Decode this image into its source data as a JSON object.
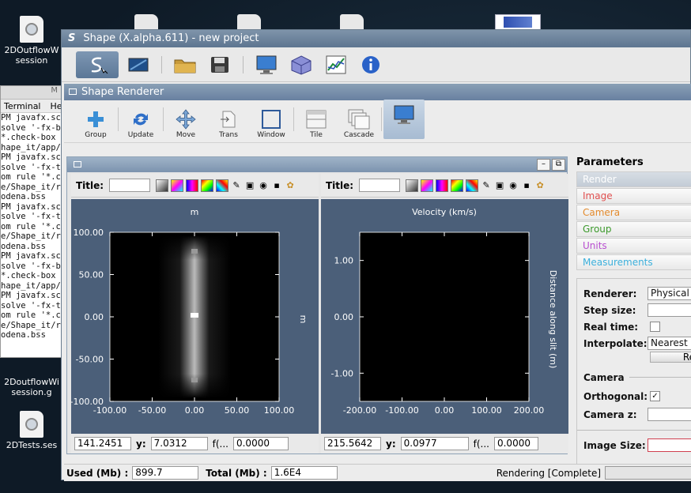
{
  "desktop": {
    "icons": [
      {
        "label": "2DOutflowW session"
      },
      {
        "label": "2DoutflowWi session.g"
      },
      {
        "label": "2DTests.ses"
      }
    ]
  },
  "terminal": {
    "title_fragment": "M",
    "menu": [
      "Terminal",
      "He"
    ],
    "lines": [
      "PM javafx.sc",
      "solve '-fx-b",
      "*.check-box",
      "hape_it/app/",
      "PM javafx.sc",
      "solve '-fx-t",
      "om rule '*.c",
      "e/Shape_it/r",
      "odena.bss",
      "PM javafx.sc",
      "solve '-fx-t",
      "om rule '*.c",
      "e/Shape_it/r",
      "odena.bss",
      "PM javafx.sc",
      "solve '-fx-b",
      "*.check-box",
      "hape_it/app/",
      "PM javafx.sc",
      "solve '-fx-t",
      "om rule '*.c",
      "e/Shape_it/r",
      "odena.bss"
    ]
  },
  "window": {
    "title": "Shape (X.alpha.611) - new project",
    "logo": "S"
  },
  "renderer": {
    "title": "Shape Renderer",
    "toolbar": [
      "Group",
      "Update",
      "Move",
      "Trans",
      "Window",
      "Tile",
      "Cascade"
    ]
  },
  "panels": [
    {
      "title_label": "Title:",
      "coords": {
        "x": "141.2451",
        "y_label": "y:",
        "y": "7.0312",
        "f_label": "f(...",
        "f": "0.0000"
      }
    },
    {
      "title_label": "Title:",
      "coords": {
        "x": "215.5642",
        "y_label": "y:",
        "y": "0.0977",
        "f_label": "f(...",
        "f": "0.0000"
      }
    }
  ],
  "chart_data": [
    {
      "type": "heatmap",
      "title": "m",
      "xlabel": "",
      "ylabel": "m",
      "xlim": [
        -100,
        100
      ],
      "ylim": [
        -100,
        100
      ],
      "xticks": [
        "-100.00",
        "-50.00",
        "0.00",
        "50.00",
        "100.00"
      ],
      "yticks": [
        "100.00",
        "50.00",
        "0.00",
        "-50.00",
        "-100.00"
      ]
    },
    {
      "type": "heatmap",
      "title": "Velocity (km/s)",
      "xlabel": "",
      "ylabel": "Distance along slit (m)",
      "xlim": [
        -200,
        200
      ],
      "ylim": [
        -1.5,
        1.5
      ],
      "xticks": [
        "-200.00",
        "-100.00",
        "0.00",
        "100.00",
        "200.00"
      ],
      "yticks": [
        "1.00",
        "0.00",
        "-1.00"
      ]
    }
  ],
  "parameters": {
    "header": "Parameters",
    "tabs": [
      {
        "label": "Render",
        "color": "#ffffff"
      },
      {
        "label": "Image",
        "color": "#e05050"
      },
      {
        "label": "Camera",
        "color": "#e38a2c"
      },
      {
        "label": "Group",
        "color": "#3c9a2c"
      },
      {
        "label": "Units",
        "color": "#b84fd0"
      },
      {
        "label": "Measurements",
        "color": "#3cb0dc"
      }
    ],
    "renderer_label": "Renderer:",
    "renderer_value": "Physical",
    "step_label": "Step size:",
    "realtime_label": "Real time:",
    "interp_label": "Interpolate:",
    "interp_value": "Nearest",
    "reset_btn": "Re",
    "camera_section": "Camera",
    "ortho_label": "Orthogonal:",
    "ortho_check": "✓",
    "cameraz_label": "Camera z:",
    "imgsize_label": "Image Size:"
  },
  "status": {
    "used_label": "Used (Mb) :",
    "used_value": "899.7",
    "total_label": "Total (Mb) :",
    "total_value": "1.6E4",
    "render_status": "Rendering [Complete]"
  }
}
